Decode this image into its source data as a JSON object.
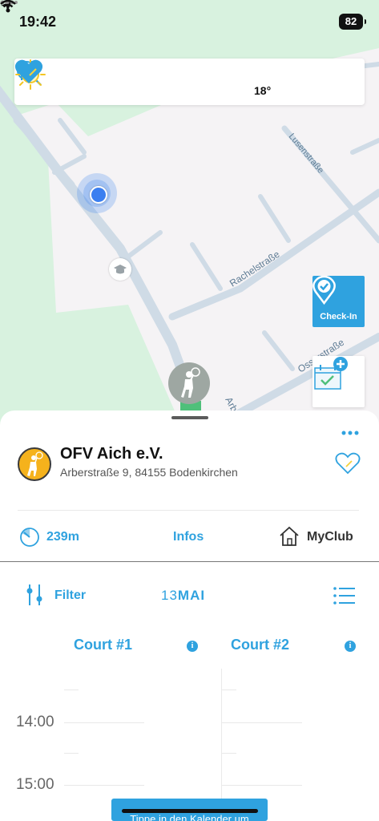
{
  "status_bar": {
    "time": "19:42",
    "battery": "82"
  },
  "map": {
    "temperature": "18°",
    "streets": [
      "Lusenstraße",
      "Rachelstraße",
      "Osserstraße",
      "Arb"
    ],
    "checkin_label": "Check-In"
  },
  "club": {
    "name": "OFV Aich e.V.",
    "address": "Arberstraße 9, 84155 Bodenkirchen"
  },
  "info_row": {
    "distance": "239m",
    "infos_label": "Infos",
    "myclub_label": "MyClub"
  },
  "filter_row": {
    "filter_label": "Filter",
    "date_day": "13",
    "date_month": "MAI"
  },
  "courts": [
    {
      "name": "Court #1"
    },
    {
      "name": "Court #2"
    }
  ],
  "times": [
    "14:00",
    "15:00"
  ],
  "toast_text": "Tippe in den Kalender um",
  "colors": {
    "accent": "#2fa2df",
    "map_green": "#d8f2df",
    "map_road": "#cfdbe6",
    "club_yellow": "#f5b21c"
  }
}
